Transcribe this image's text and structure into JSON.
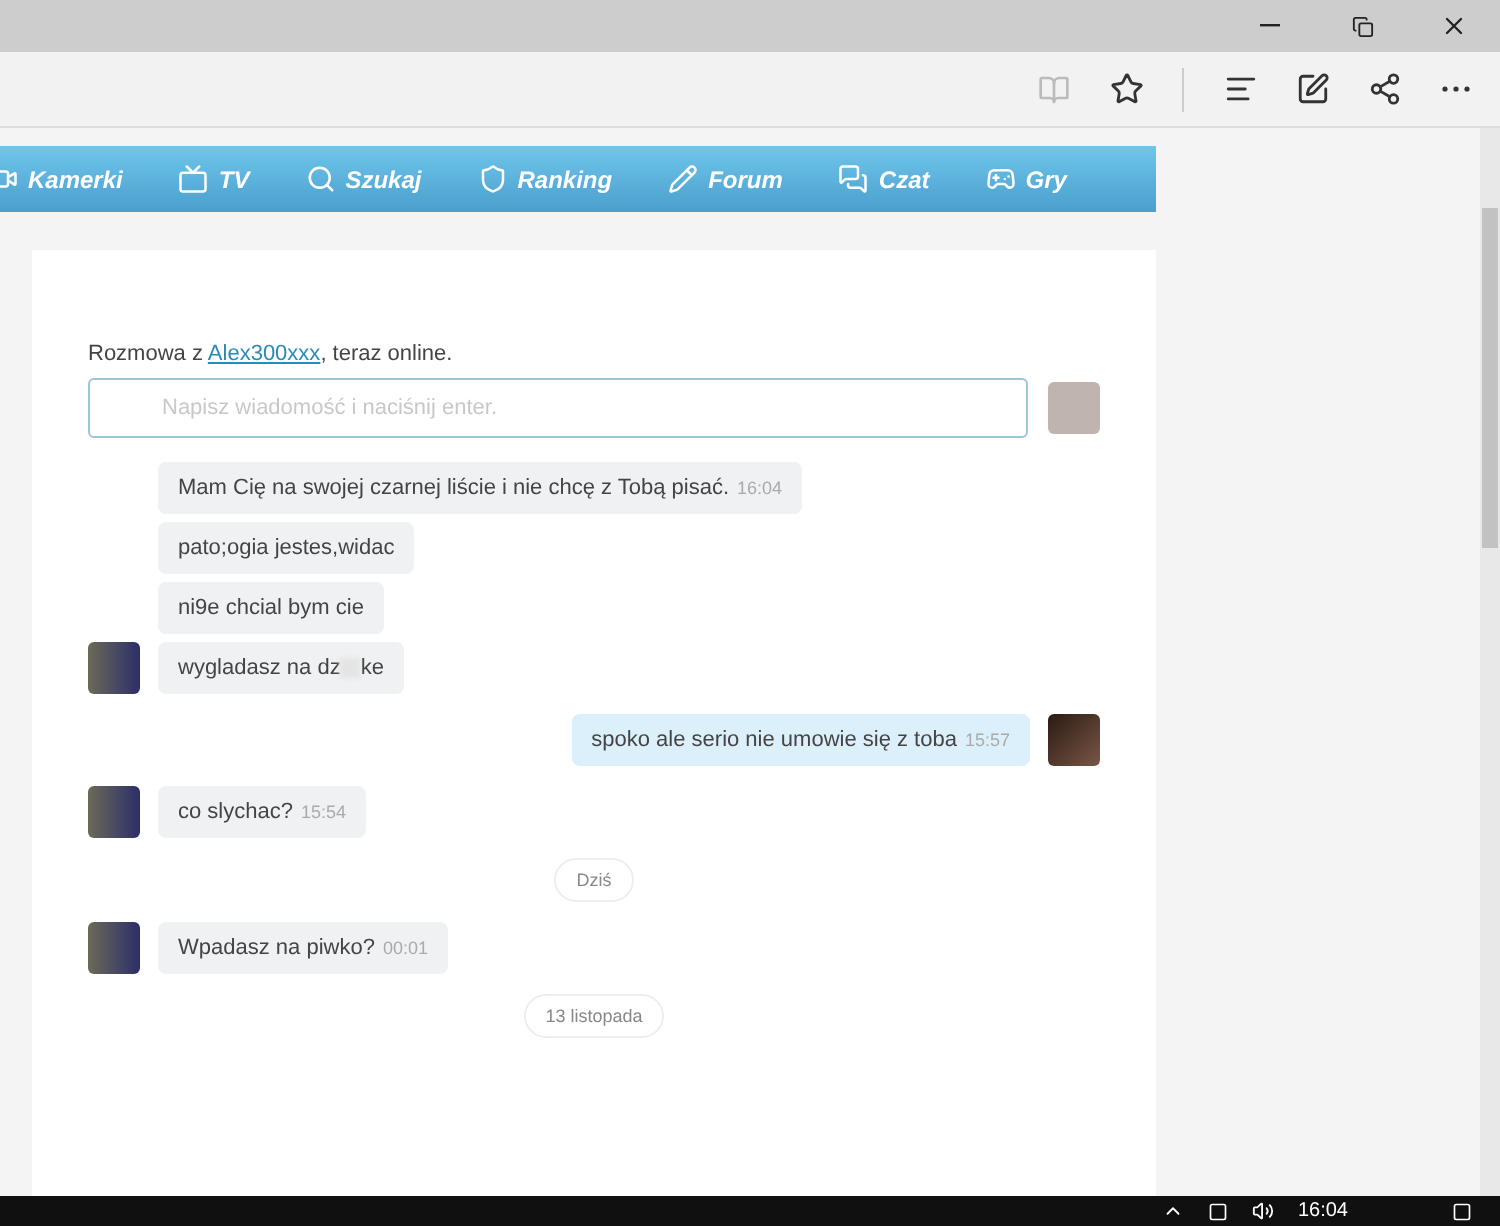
{
  "nav": {
    "items": [
      {
        "label": "Kamerki"
      },
      {
        "label": "TV"
      },
      {
        "label": "Szukaj"
      },
      {
        "label": "Ranking"
      },
      {
        "label": "Forum"
      },
      {
        "label": "Czat"
      },
      {
        "label": "Gry"
      }
    ]
  },
  "chat": {
    "intro_before": "Rozmowa z ",
    "partner": "Alex300xxx",
    "intro_after": ", teraz online.",
    "input": {
      "placeholder": "Napisz wiadomość i naciśnij enter."
    },
    "items": [
      {
        "kind": "incoming",
        "avatar": false,
        "text": "Mam Cię na swojej czarnej liście i nie chcę z Tobą pisać.",
        "time": "16:04"
      },
      {
        "kind": "incoming",
        "avatar": false,
        "text": "pato;ogia jestes,widac"
      },
      {
        "kind": "incoming",
        "avatar": false,
        "text": "ni9e chcial bym cie"
      },
      {
        "kind": "incoming",
        "avatar": true,
        "text": "wygladasz na dz",
        "censored": true,
        "text_after": "ke"
      },
      {
        "kind": "outgoing",
        "avatar": true,
        "text": "spoko ale serio nie umowie się z toba",
        "time": "15:57"
      },
      {
        "kind": "incoming",
        "avatar": true,
        "text": "co slychac?",
        "time": "15:54"
      },
      {
        "kind": "date",
        "label": "Dziś"
      },
      {
        "kind": "incoming",
        "avatar": true,
        "text": "Wpadasz na piwko?",
        "time": "00:01"
      },
      {
        "kind": "date",
        "label": "13 listopada"
      }
    ]
  },
  "taskbar": {
    "time": "16:04"
  }
}
